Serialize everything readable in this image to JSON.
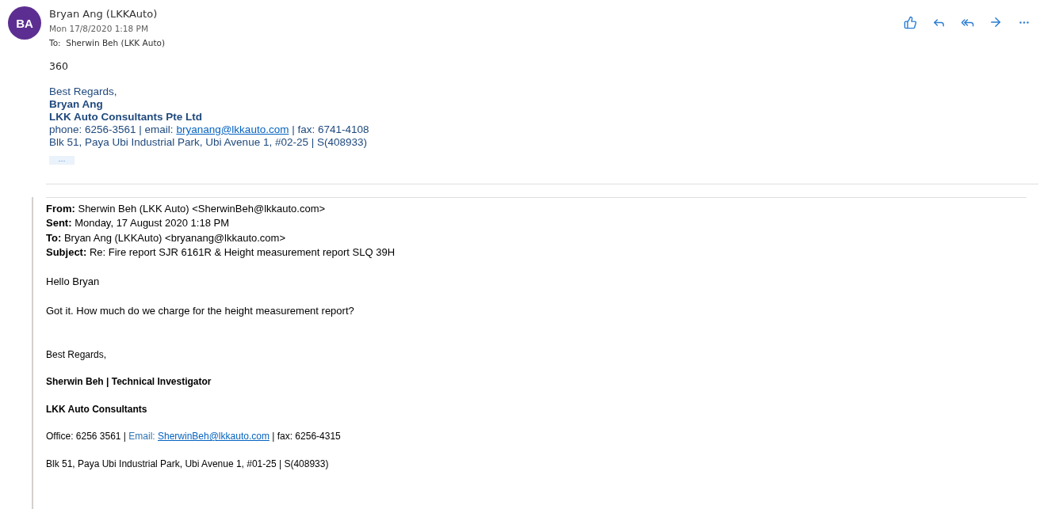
{
  "message": {
    "avatar_initials": "BA",
    "sender": "Bryan Ang (LKKAuto)",
    "date": "Mon 17/8/2020 1:18 PM",
    "to_label": "To:",
    "to": "Sherwin Beh (LKK Auto)",
    "body": "360",
    "signature": [
      {
        "kind": "plain",
        "text": "Best Regards,"
      },
      {
        "kind": "bold",
        "text": "Bryan Ang"
      },
      {
        "kind": "bold",
        "text": "LKK Auto Consultants Pte Ltd"
      },
      {
        "kind": "contact",
        "before": "phone: 6256-3561 | email: ",
        "link": "bryanang@lkkauto.com",
        "after": " | fax: 6741-4108"
      },
      {
        "kind": "plain",
        "text": "Blk 51, Paya Ubi Industrial Park, Ubi Avenue 1, #02-25 | S(408933)"
      }
    ],
    "more_button": "···"
  },
  "actions": [
    {
      "kind": "like"
    },
    {
      "kind": "reply"
    },
    {
      "kind": "reply_all"
    },
    {
      "kind": "forward"
    },
    {
      "kind": "more"
    }
  ],
  "quoted": {
    "headers": [
      {
        "label": "From:",
        "value": "Sherwin Beh (LKK Auto) <SherwinBeh@lkkauto.com>"
      },
      {
        "label": "Sent:",
        "value": "Monday, 17 August 2020 1:18 PM"
      },
      {
        "label": "To:",
        "value": "Bryan Ang (LKKAuto) <bryanang@lkkauto.com>"
      },
      {
        "label": "Subject:",
        "value": "Re: Fire report SJR 6161R & Height measurement report SLQ 39H"
      }
    ],
    "greeting": "Hello Bryan",
    "body": "Got it. How much do we charge for the height measurement report?",
    "sign_off": "Best Regards,",
    "name_line": "Sherwin Beh | Technical Investigator",
    "company": "LKK Auto Consultants",
    "contact": {
      "office": "Office: 6256 3561  |",
      "email_label": " Email: ",
      "email": " SherwinBeh@lkkauto.com",
      "after": " | fax: 6256-4315"
    },
    "address": "Blk 51, Paya Ubi Industrial Park, Ubi Avenue 1, #01-25 | S(408933)"
  }
}
